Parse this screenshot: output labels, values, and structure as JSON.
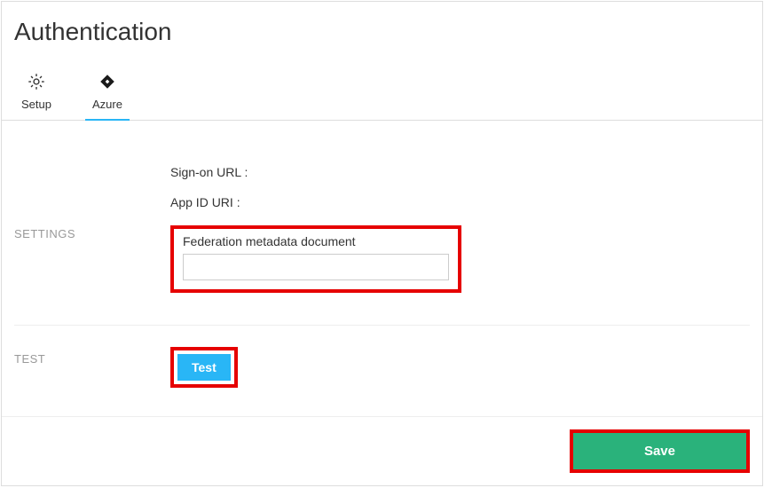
{
  "page": {
    "title": "Authentication"
  },
  "tabs": {
    "setup": "Setup",
    "azure": "Azure"
  },
  "sections": {
    "settings_label": "SETTINGS",
    "test_label": "TEST"
  },
  "fields": {
    "signon": "Sign-on URL :",
    "appid": "App ID URI :",
    "federation_label": "Federation metadata document",
    "federation_value": ""
  },
  "buttons": {
    "test": "Test",
    "save": "Save"
  }
}
